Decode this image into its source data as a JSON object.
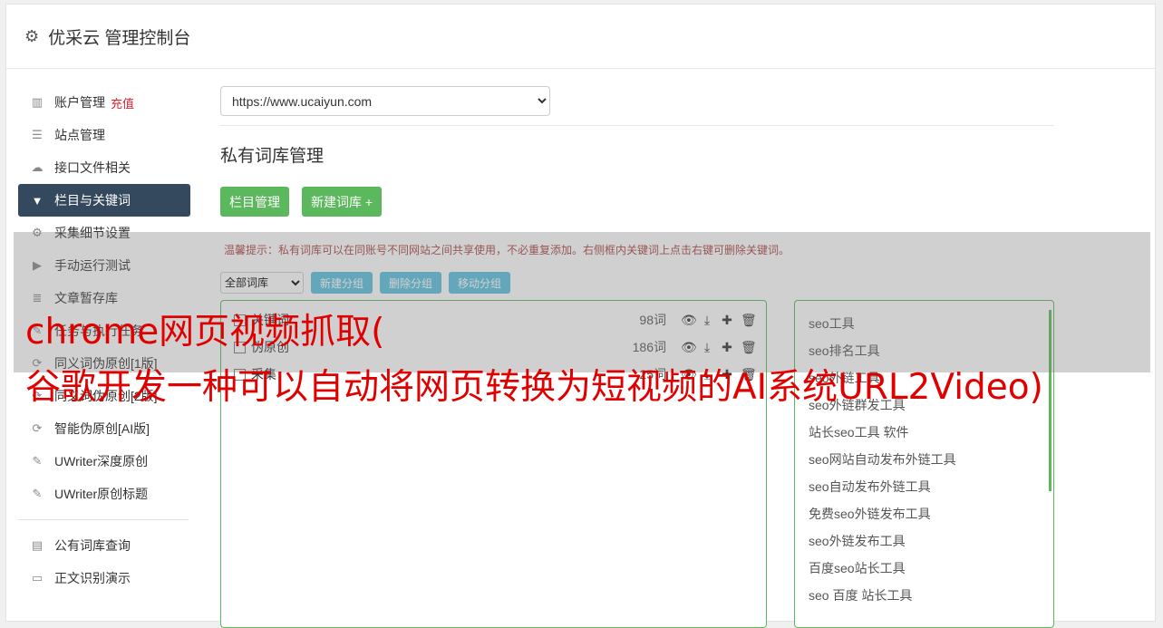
{
  "header": {
    "title": "优采云 管理控制台",
    "icon": "gear-icon"
  },
  "sidebar": {
    "items": [
      {
        "label": "账户管理",
        "badge": "充值",
        "icon": "chart-icon"
      },
      {
        "label": "站点管理",
        "icon": "server-icon"
      },
      {
        "label": "接口文件相关",
        "icon": "cloud-upload-icon"
      },
      {
        "label": "栏目与关键词",
        "icon": "filter-icon",
        "active": true
      },
      {
        "label": "采集细节设置",
        "icon": "cogs-icon"
      },
      {
        "label": "手动运行测试",
        "icon": "play-icon"
      },
      {
        "label": "文章暂存库",
        "icon": "database-icon"
      },
      {
        "label": "任务与执行任务",
        "icon": "task-icon"
      },
      {
        "label": "同义词伪原创[1版]",
        "icon": "refresh-icon"
      },
      {
        "label": "同义词伪原创[2版]",
        "icon": "refresh-icon"
      },
      {
        "label": "智能伪原创[AI版]",
        "icon": "refresh-icon"
      },
      {
        "label": "UWriter深度原创",
        "icon": "edit-icon"
      },
      {
        "label": "UWriter原创标题",
        "icon": "edit-icon"
      }
    ],
    "items2": [
      {
        "label": "公有词库查询",
        "icon": "book-icon"
      },
      {
        "label": "正文识别演示",
        "icon": "monitor-icon"
      }
    ]
  },
  "main": {
    "site_select": "https://www.ucaiyun.com",
    "section_title": "私有词库管理",
    "btn_column": "栏目管理",
    "btn_new_lib": "新建词库 +",
    "tip": "温馨提示：私有词库可以在同账号不同网站之间共享使用，不必重复添加。右侧框内关键词上点击右键可删除关键词。",
    "group_select": "全部词库",
    "btn_new_group": "新建分组",
    "btn_del_group": "删除分组",
    "btn_move_group": "移动分组",
    "libraries": [
      {
        "name": "关键词",
        "count": "98词"
      },
      {
        "name": "伪原创",
        "count": "186词"
      },
      {
        "name": "采集",
        "count": "25词"
      }
    ],
    "keywords": [
      "seo工具",
      "seo排名工具",
      "seo外链工具",
      "seo外链群发工具",
      "站长seo工具 软件",
      "seo网站自动发布外链工具",
      "seo自动发布外链工具",
      "免费seo外链发布工具",
      "seo外链发布工具",
      "百度seo站长工具",
      "seo 百度 站长工具"
    ]
  },
  "overlay": {
    "line1": "chrome网页视频抓取(",
    "line2": "谷歌开发一种可以自动将网页转换为短视频的AI系统URL2Video)"
  },
  "colors": {
    "green": "#5cb85c",
    "blue": "#5bc0de",
    "nav_active": "#34495e",
    "overlay_text": "#e00000"
  }
}
